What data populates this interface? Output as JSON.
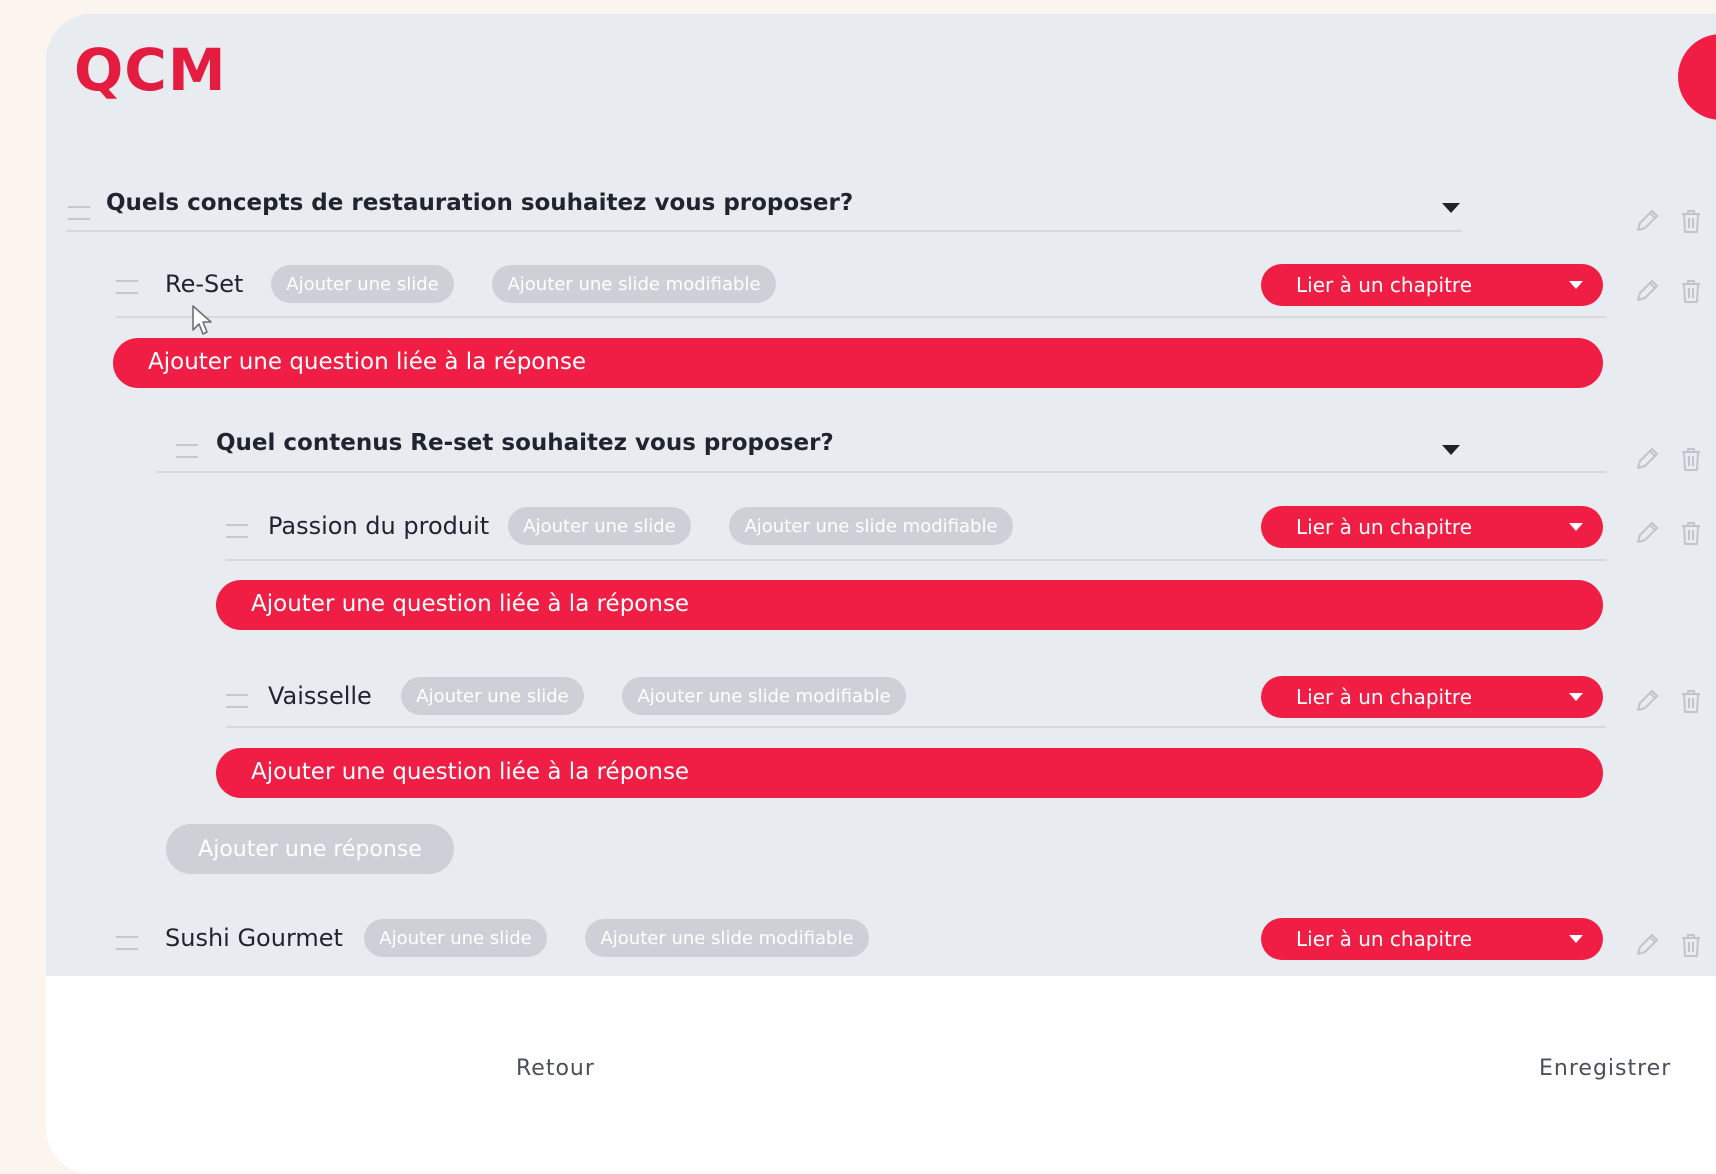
{
  "app": {
    "logo": "QCM"
  },
  "labels": {
    "add_slide": "Ajouter une slide",
    "add_slide_editable": "Ajouter une slide modifiable",
    "link_chapter": "Lier à un chapitre",
    "add_linked_question": "Ajouter une question liée à la réponse",
    "add_answer": "Ajouter une réponse"
  },
  "questions": [
    {
      "text": "Quels concepts de restauration souhaitez vous proposer?",
      "answers": [
        {
          "label": "Re-Set"
        },
        {
          "label": "Sushi Gourmet"
        }
      ]
    },
    {
      "text": "Quel contenus Re-set souhaitez vous proposer?",
      "answers": [
        {
          "label": "Passion du produit"
        },
        {
          "label": "Vaisselle"
        }
      ]
    }
  ],
  "footer": {
    "back": "Retour",
    "save": "Enregistrer"
  },
  "colors": {
    "accent": "#f01e44",
    "background": "#e8ebf0",
    "disabled_pill": "#cdd0d6"
  },
  "icons": [
    "drag-handle-icon",
    "caret-down-icon",
    "pencil-icon",
    "trash-icon",
    "cursor-icon"
  ]
}
